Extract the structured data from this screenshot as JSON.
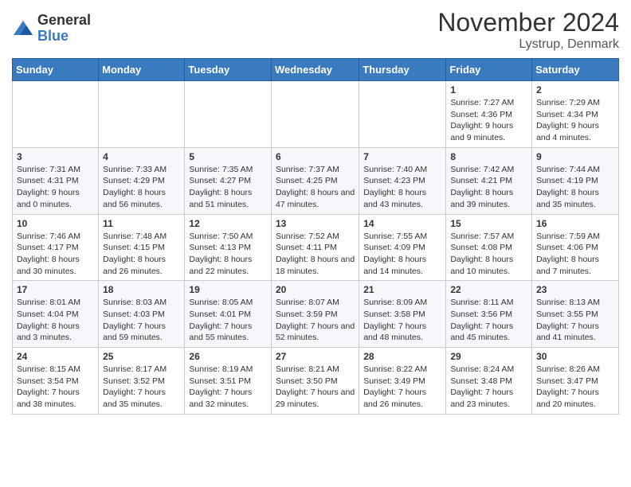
{
  "logo": {
    "general": "General",
    "blue": "Blue"
  },
  "title": "November 2024",
  "location": "Lystrup, Denmark",
  "days_of_week": [
    "Sunday",
    "Monday",
    "Tuesday",
    "Wednesday",
    "Thursday",
    "Friday",
    "Saturday"
  ],
  "weeks": [
    [
      {
        "day": "",
        "info": ""
      },
      {
        "day": "",
        "info": ""
      },
      {
        "day": "",
        "info": ""
      },
      {
        "day": "",
        "info": ""
      },
      {
        "day": "",
        "info": ""
      },
      {
        "day": "1",
        "info": "Sunrise: 7:27 AM\nSunset: 4:36 PM\nDaylight: 9 hours and 9 minutes."
      },
      {
        "day": "2",
        "info": "Sunrise: 7:29 AM\nSunset: 4:34 PM\nDaylight: 9 hours and 4 minutes."
      }
    ],
    [
      {
        "day": "3",
        "info": "Sunrise: 7:31 AM\nSunset: 4:31 PM\nDaylight: 9 hours and 0 minutes."
      },
      {
        "day": "4",
        "info": "Sunrise: 7:33 AM\nSunset: 4:29 PM\nDaylight: 8 hours and 56 minutes."
      },
      {
        "day": "5",
        "info": "Sunrise: 7:35 AM\nSunset: 4:27 PM\nDaylight: 8 hours and 51 minutes."
      },
      {
        "day": "6",
        "info": "Sunrise: 7:37 AM\nSunset: 4:25 PM\nDaylight: 8 hours and 47 minutes."
      },
      {
        "day": "7",
        "info": "Sunrise: 7:40 AM\nSunset: 4:23 PM\nDaylight: 8 hours and 43 minutes."
      },
      {
        "day": "8",
        "info": "Sunrise: 7:42 AM\nSunset: 4:21 PM\nDaylight: 8 hours and 39 minutes."
      },
      {
        "day": "9",
        "info": "Sunrise: 7:44 AM\nSunset: 4:19 PM\nDaylight: 8 hours and 35 minutes."
      }
    ],
    [
      {
        "day": "10",
        "info": "Sunrise: 7:46 AM\nSunset: 4:17 PM\nDaylight: 8 hours and 30 minutes."
      },
      {
        "day": "11",
        "info": "Sunrise: 7:48 AM\nSunset: 4:15 PM\nDaylight: 8 hours and 26 minutes."
      },
      {
        "day": "12",
        "info": "Sunrise: 7:50 AM\nSunset: 4:13 PM\nDaylight: 8 hours and 22 minutes."
      },
      {
        "day": "13",
        "info": "Sunrise: 7:52 AM\nSunset: 4:11 PM\nDaylight: 8 hours and 18 minutes."
      },
      {
        "day": "14",
        "info": "Sunrise: 7:55 AM\nSunset: 4:09 PM\nDaylight: 8 hours and 14 minutes."
      },
      {
        "day": "15",
        "info": "Sunrise: 7:57 AM\nSunset: 4:08 PM\nDaylight: 8 hours and 10 minutes."
      },
      {
        "day": "16",
        "info": "Sunrise: 7:59 AM\nSunset: 4:06 PM\nDaylight: 8 hours and 7 minutes."
      }
    ],
    [
      {
        "day": "17",
        "info": "Sunrise: 8:01 AM\nSunset: 4:04 PM\nDaylight: 8 hours and 3 minutes."
      },
      {
        "day": "18",
        "info": "Sunrise: 8:03 AM\nSunset: 4:03 PM\nDaylight: 7 hours and 59 minutes."
      },
      {
        "day": "19",
        "info": "Sunrise: 8:05 AM\nSunset: 4:01 PM\nDaylight: 7 hours and 55 minutes."
      },
      {
        "day": "20",
        "info": "Sunrise: 8:07 AM\nSunset: 3:59 PM\nDaylight: 7 hours and 52 minutes."
      },
      {
        "day": "21",
        "info": "Sunrise: 8:09 AM\nSunset: 3:58 PM\nDaylight: 7 hours and 48 minutes."
      },
      {
        "day": "22",
        "info": "Sunrise: 8:11 AM\nSunset: 3:56 PM\nDaylight: 7 hours and 45 minutes."
      },
      {
        "day": "23",
        "info": "Sunrise: 8:13 AM\nSunset: 3:55 PM\nDaylight: 7 hours and 41 minutes."
      }
    ],
    [
      {
        "day": "24",
        "info": "Sunrise: 8:15 AM\nSunset: 3:54 PM\nDaylight: 7 hours and 38 minutes."
      },
      {
        "day": "25",
        "info": "Sunrise: 8:17 AM\nSunset: 3:52 PM\nDaylight: 7 hours and 35 minutes."
      },
      {
        "day": "26",
        "info": "Sunrise: 8:19 AM\nSunset: 3:51 PM\nDaylight: 7 hours and 32 minutes."
      },
      {
        "day": "27",
        "info": "Sunrise: 8:21 AM\nSunset: 3:50 PM\nDaylight: 7 hours and 29 minutes."
      },
      {
        "day": "28",
        "info": "Sunrise: 8:22 AM\nSunset: 3:49 PM\nDaylight: 7 hours and 26 minutes."
      },
      {
        "day": "29",
        "info": "Sunrise: 8:24 AM\nSunset: 3:48 PM\nDaylight: 7 hours and 23 minutes."
      },
      {
        "day": "30",
        "info": "Sunrise: 8:26 AM\nSunset: 3:47 PM\nDaylight: 7 hours and 20 minutes."
      }
    ]
  ]
}
